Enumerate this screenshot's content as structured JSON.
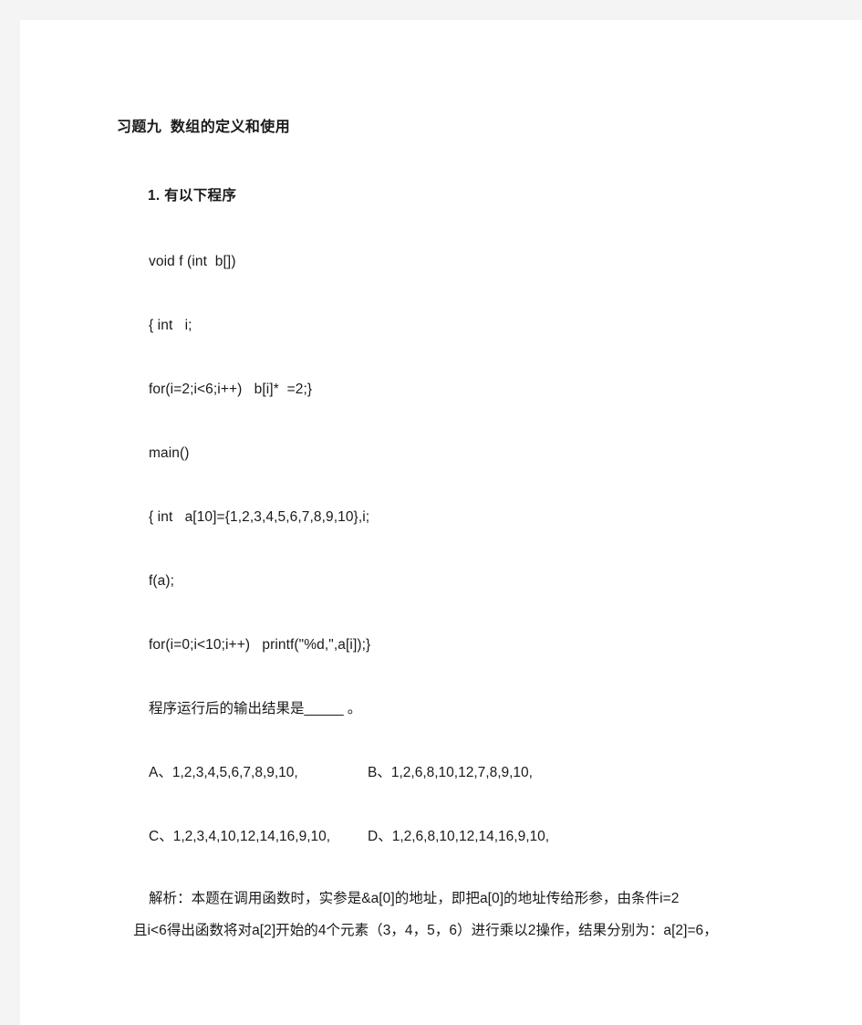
{
  "document": {
    "title": "习题九  数组的定义和使用",
    "question_number": "1.",
    "question_label": "1. 有以下程序",
    "code_lines": [
      "void f (int  b[])",
      "{ int   i;",
      "for(i=2;i<6;i++)   b[i]*  =2;}",
      "main()",
      "{ int   a[10]={1,2,3,4,5,6,7,8,9,10},i;",
      "f(a);",
      "for(i=0;i<10;i++)   printf(\"%d,\",a[i]);}"
    ],
    "prompt": "程序运行后的输出结果是_____ 。",
    "options": [
      {
        "key": "A、",
        "text": "1,2,3,4,5,6,7,8,9,10,"
      },
      {
        "key": "B、",
        "text": "1,2,6,8,10,12,7,8,9,10,"
      },
      {
        "key": "C、",
        "text": "1,2,3,4,10,12,14,16,9,10,"
      },
      {
        "key": "D、",
        "text": "1,2,6,8,10,12,14,16,9,10,"
      }
    ],
    "explanation_lines": [
      "解析：本题在调用函数时，实参是&a[0]的地址，即把a[0]的地址传给形参，由条件i=2",
      "且i<6得出函数将对a[2]开始的4个元素（3，4，5，6）进行乘以2操作，结果分别为：a[2]=6，"
    ]
  },
  "colors": {
    "page_background": "#ffffff",
    "canvas_background": "#f4f4f4",
    "text": "#1a1a1a"
  }
}
